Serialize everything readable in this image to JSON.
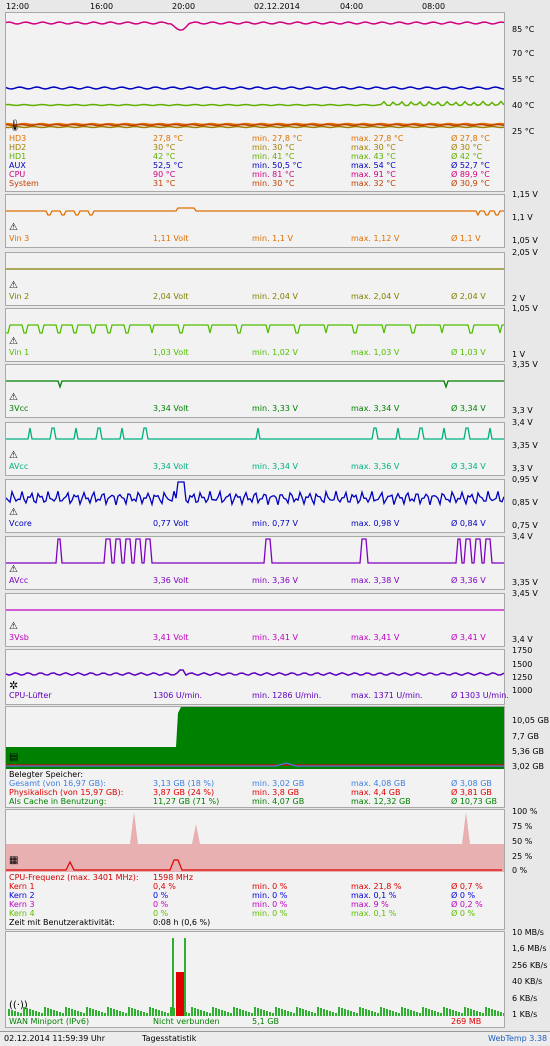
{
  "time_axis": [
    "12:00",
    "16:00",
    "20:00",
    "02.12.2014",
    "04:00",
    "08:00"
  ],
  "temperature": {
    "y_labels": [
      "85 °C",
      "70 °C",
      "55 °C",
      "40 °C",
      "25 °C"
    ],
    "rows": [
      {
        "name": "HD3",
        "current": "27,8 °C",
        "min": "min. 27,8 °C",
        "max": "max. 27,8 °C",
        "avg": "Ø 27,8 °C",
        "color": "#e07000"
      },
      {
        "name": "HD2",
        "current": "30 °C",
        "min": "min. 30 °C",
        "max": "max. 30 °C",
        "avg": "Ø 30 °C",
        "color": "#a08000"
      },
      {
        "name": "HD1",
        "current": "42 °C",
        "min": "min. 41 °C",
        "max": "max. 43 °C",
        "avg": "Ø 42 °C",
        "color": "#60b000"
      },
      {
        "name": "AUX",
        "current": "52,5 °C",
        "min": "min. 50,5 °C",
        "max": "max. 54 °C",
        "avg": "Ø 52,7 °C",
        "color": "#0000c0"
      },
      {
        "name": "CPU",
        "current": "90 °C",
        "min": "min. 81 °C",
        "max": "max. 91 °C",
        "avg": "Ø 89,9 °C",
        "color": "#d00080"
      },
      {
        "name": "System",
        "current": "31 °C",
        "min": "min. 30 °C",
        "max": "max. 32 °C",
        "avg": "Ø 30,9 °C",
        "color": "#c04000"
      }
    ]
  },
  "voltages": [
    {
      "name": "Vin 3",
      "current": "1,11 Volt",
      "min": "min. 1,1 V",
      "max": "max. 1,12 V",
      "avg": "Ø 1,1 V",
      "color": "#e07000",
      "y_labels": [
        "1,15 V",
        "1,1 V",
        "1,05 V"
      ],
      "pattern": "dips_cluster"
    },
    {
      "name": "Vin 2",
      "current": "2,04 Volt",
      "min": "min. 2,04 V",
      "max": "max. 2,04 V",
      "avg": "Ø 2,04 V",
      "color": "#808000",
      "y_labels": [
        "2,05 V",
        "2 V"
      ],
      "pattern": "flat"
    },
    {
      "name": "Vin 1",
      "current": "1,03 Volt",
      "min": "min. 1,02 V",
      "max": "max. 1,03 V",
      "avg": "Ø 1,03 V",
      "color": "#50c000",
      "y_labels": [
        "1,05 V",
        "1 V"
      ],
      "pattern": "dips_many"
    },
    {
      "name": "3Vcc",
      "current": "3,34 Volt",
      "min": "min. 3,33 V",
      "max": "max. 3,34 V",
      "avg": "Ø 3,34 V",
      "color": "#008000",
      "y_labels": [
        "3,35 V",
        "3,3 V"
      ],
      "pattern": "dips_two"
    },
    {
      "name": "AVcc",
      "current": "3,34 Volt",
      "min": "min. 3,34 V",
      "max": "max. 3,36 V",
      "avg": "Ø 3,34 V",
      "color": "#00b080",
      "y_labels": [
        "3,4 V",
        "3,35 V",
        "3,3 V"
      ],
      "pattern": "spikes"
    },
    {
      "name": "Vcore",
      "current": "0,77 Volt",
      "min": "min. 0,77 V",
      "max": "max. 0,98 V",
      "avg": "Ø 0,84 V",
      "color": "#0000c0",
      "y_labels": [
        "0,95 V",
        "0,85 V",
        "0,75 V"
      ],
      "pattern": "noisy"
    },
    {
      "name": "AVcc",
      "current": "3,36 Volt",
      "min": "min. 3,36 V",
      "max": "max. 3,38 V",
      "avg": "Ø 3,36 V",
      "color": "#8000c0",
      "y_labels": [
        "3,4 V",
        "3,35 V"
      ],
      "pattern": "pulses"
    },
    {
      "name": "3Vsb",
      "current": "3,41 Volt",
      "min": "min. 3,41 V",
      "max": "max. 3,41 V",
      "avg": "Ø 3,41 V",
      "color": "#c000c0",
      "y_labels": [
        "3,45 V",
        "3,4 V"
      ],
      "pattern": "flat"
    }
  ],
  "fan": {
    "name": "CPU-Lüfter",
    "current": "1306 U/min.",
    "min": "min. 1286 U/min.",
    "max": "max. 1371 U/min.",
    "avg": "Ø 1303 U/min.",
    "color": "#6000c0",
    "y_labels": [
      "1750",
      "1500",
      "1250",
      "1000"
    ]
  },
  "memory": {
    "title": "Belegter Speicher:",
    "y_labels": [
      "10,05 GB",
      "7,7 GB",
      "5,36 GB",
      "3,02 GB"
    ],
    "rows": [
      {
        "name": "Gesamt (von 16,97 GB):",
        "current": "3,13 GB (18 %)",
        "min": "min. 3,02 GB",
        "max": "max. 4,08 GB",
        "avg": "Ø 3,08 GB",
        "color": "#4080e0"
      },
      {
        "name": "Physikalisch (von 15,97 GB):",
        "current": "3,87 GB (24 %)",
        "min": "min. 3,8 GB",
        "max": "max. 4,4 GB",
        "avg": "Ø 3,81 GB",
        "color": "#e00000"
      },
      {
        "name": "Als Cache in Benutzung:",
        "current": "11,27 GB (71 %)",
        "min": "min. 4,07 GB",
        "max": "max. 12,32 GB",
        "avg": "Ø 10,73 GB",
        "color": "#008000"
      }
    ]
  },
  "cpu": {
    "title": "CPU-Frequenz (max. 3401 MHz):",
    "freq": "1598 MHz",
    "y_labels": [
      "100 %",
      "75 %",
      "50 %",
      "25 %",
      "0 %"
    ],
    "rows": [
      {
        "name": "Kern 1",
        "current": "0,4 %",
        "min": "min. 0 %",
        "max": "max. 21,8 %",
        "avg": "Ø 0,7 %",
        "color": "#e00000"
      },
      {
        "name": "Kern 2",
        "current": "0 %",
        "min": "min. 0 %",
        "max": "max. 0,1 %",
        "avg": "Ø 0 %",
        "color": "#0000e0"
      },
      {
        "name": "Kern 3",
        "current": "0 %",
        "min": "min. 0 %",
        "max": "max. 9 %",
        "avg": "Ø 0,2 %",
        "color": "#c000c0"
      },
      {
        "name": "Kern 4",
        "current": "0 %",
        "min": "min. 0 %",
        "max": "max. 0,1 %",
        "avg": "Ø 0 %",
        "color": "#60c000"
      }
    ],
    "activity_label": "Zeit mit Benutzeraktivität:",
    "activity_value": "0:08 h (0,6 %)"
  },
  "network": {
    "y_labels": [
      "10 MB/s",
      "1,6 MB/s",
      "256 KB/s",
      "40 KB/s",
      "6 KB/s",
      "1 KB/s"
    ],
    "name": "WAN Miniport (IPv6)",
    "status": "Nicht verbunden",
    "received": "5,1 GB",
    "sent": "269 MB"
  },
  "footer": {
    "datetime": "02.12.2014 11:59:39 Uhr",
    "link": "Tagesstatistik",
    "brand": "WebTemp 3.38"
  }
}
